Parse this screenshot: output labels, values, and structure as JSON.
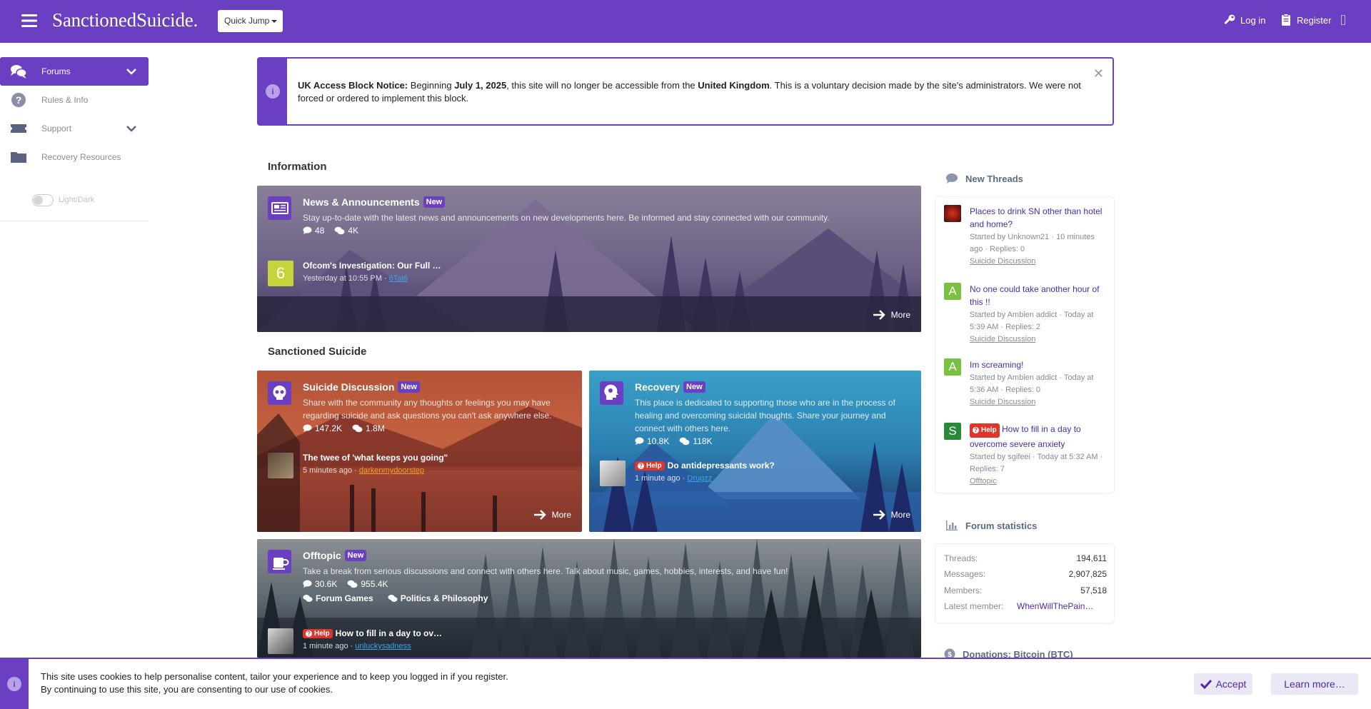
{
  "header": {
    "logo": "SanctionedSuicide.",
    "quick_jump": "Quick Jump",
    "login": "Log in",
    "register": "Register"
  },
  "sidebar": {
    "items": [
      {
        "label": "Forums",
        "icon": "comments-icon"
      },
      {
        "label": "Rules & Info",
        "icon": "question-circle-icon"
      },
      {
        "label": "Support",
        "icon": "ticket-icon"
      },
      {
        "label": "Recovery Resources",
        "icon": "folder-icon"
      }
    ],
    "toggle_label": "Light/Dark"
  },
  "notice": {
    "prefix": " ",
    "title": "UK Access Block Notice:",
    "t1": " Beginning ",
    "date": "July 1, 2025",
    "t2": ", this site will no longer be accessible from the ",
    "country": "United Kingdom",
    "t3": ". This is a voluntary decision made by the site's administrators. We were not forced or ordered to implement this block.",
    "close": "✕"
  },
  "sections": {
    "information": "Information",
    "sanctioned": "Sanctioned Suicide"
  },
  "cards": {
    "news": {
      "title": "News & Announcements",
      "badge": "New",
      "desc": "Stay up-to-date with the latest news and announcements on new developments here. Be informed and stay connected with our community.",
      "threads": "48",
      "messages": "4K",
      "latest_title": "Ofcom's Investigation: Our Full …",
      "latest_time": "Yesterday at 10:55 PM",
      "latest_user": "6Tal6",
      "avatar_letter": "6",
      "more": "More"
    },
    "suicide": {
      "title": "Suicide Discussion",
      "badge": "New",
      "desc1": "Share with the community any thoughts or feelings you may have",
      "desc2": "regarding suicide and ask questions you can't ask anywhere else.",
      "threads": "147.2K",
      "messages": "1.8M",
      "latest_title": "The twee of 'what keeps you going\"",
      "latest_time": "5 minutes ago",
      "latest_user": "darkenmydoorstep",
      "more": "More"
    },
    "recovery": {
      "title": "Recovery",
      "badge": "New",
      "desc1": "This place is dedicated to supporting those who are in the process of",
      "desc2": "healing and overcoming suicidal thoughts. Share your journey and",
      "desc3": "connect with others here.",
      "threads": "10.8K",
      "messages": "118K",
      "latest_badge": "Help",
      "latest_title": "Do antidepressants work?",
      "latest_time": "1 minute ago",
      "latest_user": "Drugzz",
      "more": "More"
    },
    "offtopic": {
      "title": "Offtopic",
      "badge": "New",
      "desc": "Take a break from serious discussions and connect with others here. Talk about music, games, hobbies, interests, and have fun!",
      "threads": "30.6K",
      "messages": "955.4K",
      "sub1": "Forum Games",
      "sub2": "Politics & Philosophy",
      "latest_badge": "Help",
      "latest_title": "How to fill in a day to ov…",
      "latest_time": "1 minute ago",
      "latest_user": "unluckysadness"
    }
  },
  "new_threads": {
    "heading": "New Threads",
    "items": [
      {
        "title": "Places to drink SN other than hotel and home?",
        "meta": "Started by Unknown21 · 10 minutes ago · Replies: 0",
        "forum": "Suicide Discussion",
        "avatar": ""
      },
      {
        "title": "No one could take another hour of this !!",
        "meta": "Started by Ambien addict · Today at 5:39 AM · Replies: 2",
        "forum": "Suicide Discussion",
        "avatar": "A"
      },
      {
        "title": "Im screaming!",
        "meta": "Started by Ambien addict · Today at 5:36 AM · Replies: 0",
        "forum": "Suicide Discussion",
        "avatar": "A"
      },
      {
        "badge": "Help",
        "title": "How to fill in a day to overcome severe anxiety",
        "meta": "Started by sgifeei · Today at 5:32 AM · Replies: 7",
        "forum": "Offtopic",
        "avatar": "S"
      }
    ]
  },
  "forum_stats": {
    "heading": "Forum statistics",
    "threads_label": "Threads:",
    "threads": "194,611",
    "messages_label": "Messages:",
    "messages": "2,907,825",
    "members_label": "Members:",
    "members": "57,518",
    "latest_label": "Latest member:",
    "latest": "WhenWillThePain…"
  },
  "donations": {
    "heading": "Donations: Bitcoin (BTC)"
  },
  "cookie": {
    "line1": "This site uses cookies to help personalise content, tailor your experience and to keep you logged in if you register.",
    "line2": "By continuing to use this site, you are consenting to our use of cookies.",
    "accept": "Accept",
    "learn": "Learn more…"
  },
  "colors": {
    "brand": "#6a3fc2",
    "link": "#4b2bb0",
    "help": "#e0352b"
  }
}
